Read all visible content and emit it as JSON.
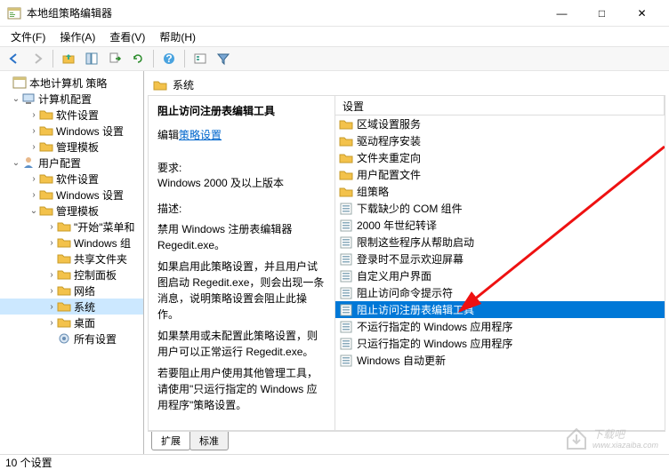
{
  "window": {
    "title": "本地组策略编辑器",
    "minimize": "—",
    "maximize": "□",
    "close": "✕"
  },
  "menubar": [
    {
      "label": "文件(F)"
    },
    {
      "label": "操作(A)"
    },
    {
      "label": "查看(V)"
    },
    {
      "label": "帮助(H)"
    }
  ],
  "toolbar_icons": [
    "back-icon",
    "forward-icon",
    "up-icon",
    "show-hide-icon",
    "export-icon",
    "refresh-icon",
    "help-icon",
    "filter-icon"
  ],
  "tree": {
    "root": "本地计算机 策略",
    "computer": {
      "label": "计算机配置",
      "children": [
        "软件设置",
        "Windows 设置",
        "管理模板"
      ]
    },
    "user": {
      "label": "用户配置",
      "children": [
        "软件设置",
        "Windows 设置"
      ],
      "admin_templates": {
        "label": "管理模板",
        "children": [
          "\"开始\"菜单和",
          "Windows 组",
          "共享文件夹",
          "控制面板",
          "网络",
          "系统",
          "桌面",
          "所有设置"
        ]
      }
    }
  },
  "content": {
    "header": "系统",
    "policy_title": "阻止访问注册表编辑工具",
    "edit_label": "编辑",
    "link": "策略设置",
    "req_label": "要求:",
    "req_value": "Windows 2000 及以上版本",
    "desc_label": "描述:",
    "desc1": "禁用 Windows 注册表编辑器 Regedit.exe。",
    "desc2": "如果启用此策略设置，并且用户试图启动 Regedit.exe，则会出现一条消息，说明策略设置会阻止此操作。",
    "desc3": "如果禁用或未配置此策略设置，则用户可以正常运行 Regedit.exe。",
    "desc4": "若要阻止用户使用其他管理工具，请使用\"只运行指定的 Windows 应用程序\"策略设置。"
  },
  "list": {
    "header": "设置",
    "items": [
      {
        "label": "区域设置服务",
        "type": "folder"
      },
      {
        "label": "驱动程序安装",
        "type": "folder"
      },
      {
        "label": "文件夹重定向",
        "type": "folder"
      },
      {
        "label": "用户配置文件",
        "type": "folder"
      },
      {
        "label": "组策略",
        "type": "folder"
      },
      {
        "label": "下载缺少的 COM 组件",
        "type": "setting"
      },
      {
        "label": "2000 年世纪转译",
        "type": "setting"
      },
      {
        "label": "限制这些程序从帮助启动",
        "type": "setting"
      },
      {
        "label": "登录时不显示欢迎屏幕",
        "type": "setting"
      },
      {
        "label": "自定义用户界面",
        "type": "setting"
      },
      {
        "label": "阻止访问命令提示符",
        "type": "setting"
      },
      {
        "label": "阻止访问注册表编辑工具",
        "type": "setting",
        "selected": true
      },
      {
        "label": "不运行指定的 Windows 应用程序",
        "type": "setting"
      },
      {
        "label": "只运行指定的 Windows 应用程序",
        "type": "setting"
      },
      {
        "label": "Windows 自动更新",
        "type": "setting"
      }
    ]
  },
  "tabs": {
    "extended": "扩展",
    "standard": "标准"
  },
  "statusbar": "10 个设置",
  "watermark": {
    "brand": "下载吧",
    "url": "www.xiazaiba.com"
  }
}
